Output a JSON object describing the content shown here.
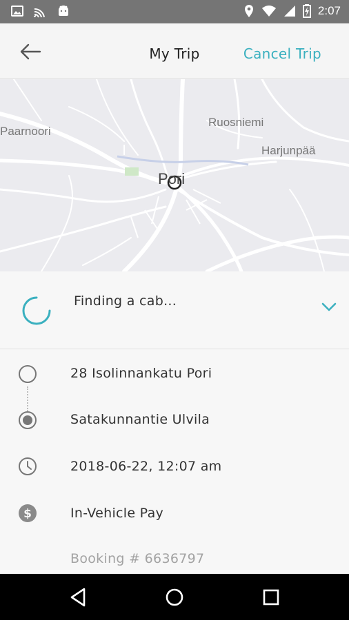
{
  "status_bar": {
    "time": "2:07",
    "icons": [
      "image-icon",
      "cast-icon",
      "android-icon",
      "location-icon",
      "wifi-icon",
      "signal-icon",
      "battery-icon"
    ]
  },
  "header": {
    "title": "My Trip",
    "cancel_label": "Cancel Trip",
    "back_icon": "arrow-back-icon"
  },
  "map": {
    "labels": {
      "paarnoori": "Paarnoori",
      "ruosniemi": "Ruosniemi",
      "harjunpaa": "Harjunpää",
      "city": "Pori"
    }
  },
  "status": {
    "text": "Finding a cab...",
    "spinner_icon": "loading-spinner-icon",
    "expand_icon": "chevron-down-icon"
  },
  "trip": {
    "pickup": "28 Isolinnankatu Pori",
    "dropoff": " Satakunnantie Ulvila",
    "datetime": "2018-06-22, 12:07 am",
    "payment": "In-Vehicle Pay",
    "booking": "Booking # 6636797"
  },
  "colors": {
    "accent": "#3ab0bf",
    "status_bar": "#757575",
    "nav_bar": "#000000"
  }
}
